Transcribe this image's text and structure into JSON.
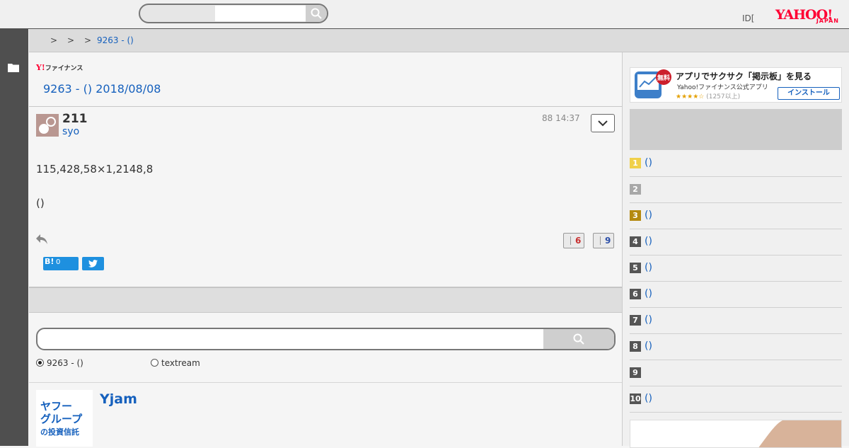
{
  "header": {
    "search_placeholder": "",
    "id_label": "ID[",
    "logo": {
      "main": "YAHOO!",
      "sub": "JAPAN"
    }
  },
  "breadcrumb": {
    "separators": [
      ">",
      ">",
      ">"
    ],
    "current": "9263 - ()"
  },
  "thread": {
    "brand": "ファイナンス",
    "brand_y": "Y!",
    "title": "9263 - () 2018/08/08"
  },
  "post": {
    "number": "211",
    "user": "syo",
    "time": "88 14:37",
    "body": [
      "115,428,58×1,2148,8",
      "()"
    ],
    "likes": "6",
    "dislikes": "9",
    "hatena_label": "B!",
    "hatena_count": "0"
  },
  "board_search": {
    "options": [
      {
        "label": "9263 - ()",
        "selected": true
      },
      {
        "label": "textream",
        "selected": false
      }
    ]
  },
  "promo": {
    "logo_lines": [
      "ヤフー",
      "グループ",
      "の投資信託"
    ],
    "title": "Yjam"
  },
  "sidebar": {
    "app_banner": {
      "badge": "無料",
      "title": "アプリでサクサク「掲示板」を見る",
      "subtitle": "Yahoo!ファイナンス公式アプリ",
      "stars": "★★★★☆",
      "rating_count": "(1257以上)",
      "install_label": "インストール"
    },
    "ranking": [
      {
        "rank": "1",
        "label": "()",
        "color": "#f0d04a"
      },
      {
        "rank": "2",
        "label": "",
        "color": "#a8a8a8"
      },
      {
        "rank": "3",
        "label": "()",
        "color": "#b48a10"
      },
      {
        "rank": "4",
        "label": "()",
        "color": "#555555"
      },
      {
        "rank": "5",
        "label": "()",
        "color": "#555555"
      },
      {
        "rank": "6",
        "label": "()",
        "color": "#555555"
      },
      {
        "rank": "7",
        "label": "()",
        "color": "#555555"
      },
      {
        "rank": "8",
        "label": "()",
        "color": "#555555"
      },
      {
        "rank": "9",
        "label": "",
        "color": "#555555"
      },
      {
        "rank": "10",
        "label": "()",
        "color": "#555555"
      }
    ]
  },
  "icons": [
    "search-icon",
    "folder-icon",
    "reply-icon",
    "chevron-down-icon",
    "twitter-icon"
  ]
}
